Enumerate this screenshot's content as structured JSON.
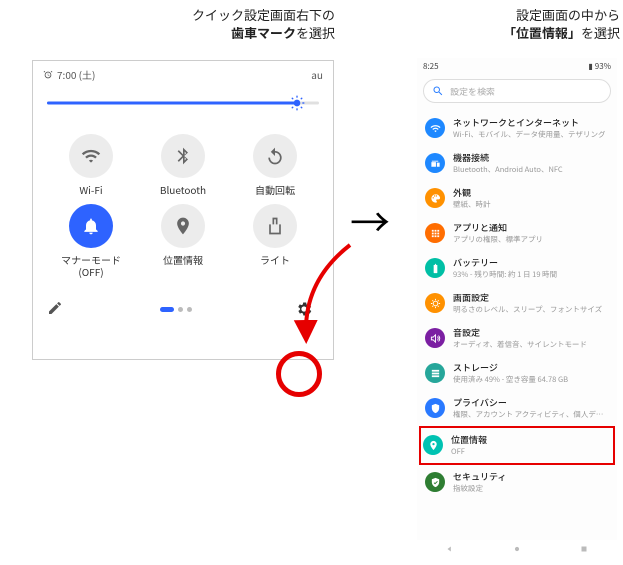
{
  "captions": {
    "left_pre": "クイック設定画面右下の",
    "left_bold": "歯車マーク",
    "left_post": "を選択",
    "right_pre": "設定画面の中から",
    "right_bold": "「位置情報」",
    "right_post": "を選択"
  },
  "quick": {
    "status": {
      "time": "7:00 (土)",
      "carrier": "au"
    },
    "tiles": [
      {
        "label": "Wi-Fi",
        "icon": "wifi",
        "active": false
      },
      {
        "label": "Bluetooth",
        "icon": "bt",
        "active": false
      },
      {
        "label": "自動回転",
        "icon": "rotate",
        "active": false
      },
      {
        "label": "マナーモード\n(OFF)",
        "icon": "bell",
        "active": true
      },
      {
        "label": "位置情報",
        "icon": "loc",
        "active": false
      },
      {
        "label": "ライト",
        "icon": "flash",
        "active": false
      }
    ]
  },
  "settings": {
    "status": {
      "time": "8:25",
      "battery": "93%"
    },
    "search_placeholder": "設定を検索",
    "items": [
      {
        "title": "ネットワークとインターネット",
        "sub": "Wi-Fi、モバイル、データ使用量、テザリング",
        "color": "#1e88ff",
        "icon": "wifi"
      },
      {
        "title": "機器接続",
        "sub": "Bluetooth、Android Auto、NFC",
        "color": "#1e88ff",
        "icon": "devices"
      },
      {
        "title": "外観",
        "sub": "壁紙、時計",
        "color": "#ff9100",
        "icon": "palette"
      },
      {
        "title": "アプリと通知",
        "sub": "アプリの権限、標準アプリ",
        "color": "#ff6d00",
        "icon": "apps"
      },
      {
        "title": "バッテリー",
        "sub": "93% - 残り時間: 約 1 日 19 時間",
        "color": "#00bfa5",
        "icon": "battery"
      },
      {
        "title": "画面設定",
        "sub": "明るさのレベル、スリープ、フォントサイズ",
        "color": "#ff9100",
        "icon": "display"
      },
      {
        "title": "音設定",
        "sub": "オーディオ、着信音、サイレントモード",
        "color": "#7b1fa2",
        "icon": "sound"
      },
      {
        "title": "ストレージ",
        "sub": "使用済み 49% - 空き容量 64.78 GB",
        "color": "#26a69a",
        "icon": "storage"
      },
      {
        "title": "プライバシー",
        "sub": "権限、アカウント アクティビティ、個人データ",
        "color": "#2979ff",
        "icon": "privacy"
      },
      {
        "title": "位置情報",
        "sub": "OFF",
        "color": "#00c2b2",
        "icon": "loc",
        "highlight": true
      },
      {
        "title": "セキュリティ",
        "sub": "指紋設定",
        "color": "#2e7d32",
        "icon": "security"
      }
    ]
  }
}
